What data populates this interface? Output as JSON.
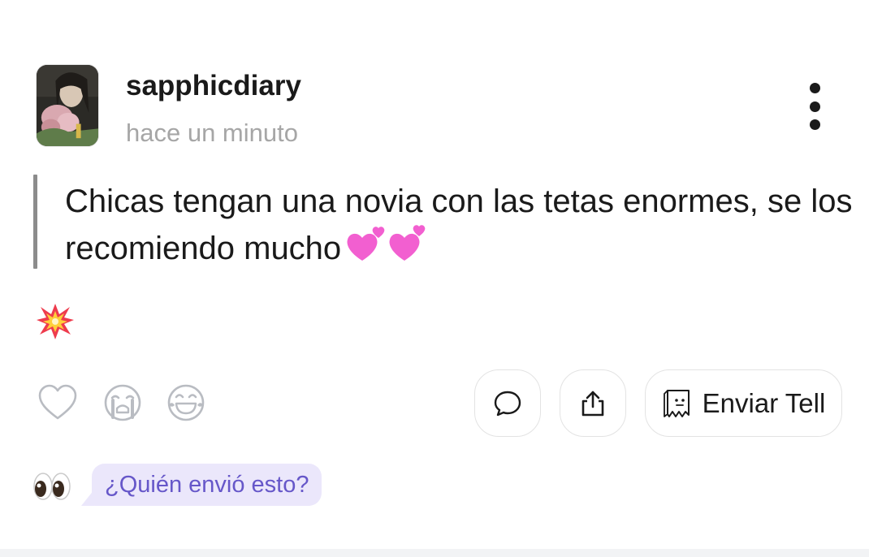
{
  "post": {
    "username": "sapphicdiary",
    "timestamp": "hace un minuto",
    "message": "Chicas tengan una novia con las tetas enormes, se los recomiendo mucho",
    "message_emoji": "two-hearts-emoji",
    "tag_emoji": "collision-emoji"
  },
  "actions": {
    "reactions": [
      "heart-icon",
      "crying-face-icon",
      "laughing-face-icon"
    ],
    "comment_icon": "speech-bubble-icon",
    "share_icon": "share-upload-icon",
    "send_tell_label": "Enviar Tell",
    "send_tell_icon": "ghost-note-icon"
  },
  "footer": {
    "eyes_emoji": "eyes-emoji",
    "who_sent_label": "¿Quién envió esto?"
  },
  "colors": {
    "text": "#1a1a1a",
    "muted": "#a6a6a6",
    "quote_bar": "#8c8c8c",
    "pill_border": "#e3e3e3",
    "bubble_bg": "#ebe7fb",
    "bubble_text": "#6657c9",
    "heart_pink": "#f25fd0"
  }
}
